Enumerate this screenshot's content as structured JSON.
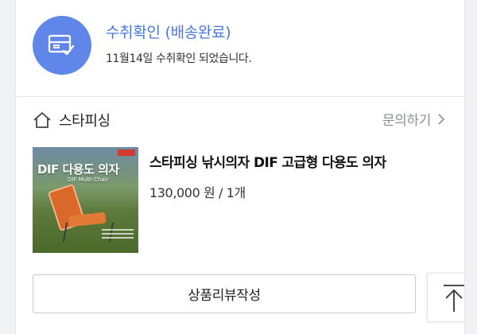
{
  "status": {
    "title": "수취확인 (배송완료)",
    "subtitle": "11월14일 수취확인 되었습니다.",
    "icon": "delivery-box-check-icon",
    "accent_color": "#4a78e0"
  },
  "store": {
    "name": "스타피싱",
    "icon": "home-icon",
    "inquiry_label": "문의하기"
  },
  "product": {
    "name": "스타피싱 낚시의자 DIF 고급형 다용도 의자",
    "price": "130,000 원 / 1개",
    "thumbnail": {
      "title": "DIF 다용도 의자",
      "subtitle": "DIF Multi Chair"
    }
  },
  "actions": {
    "review_label": "상품리뷰작성",
    "scroll_top_icon": "arrow-up-to-top-icon"
  }
}
